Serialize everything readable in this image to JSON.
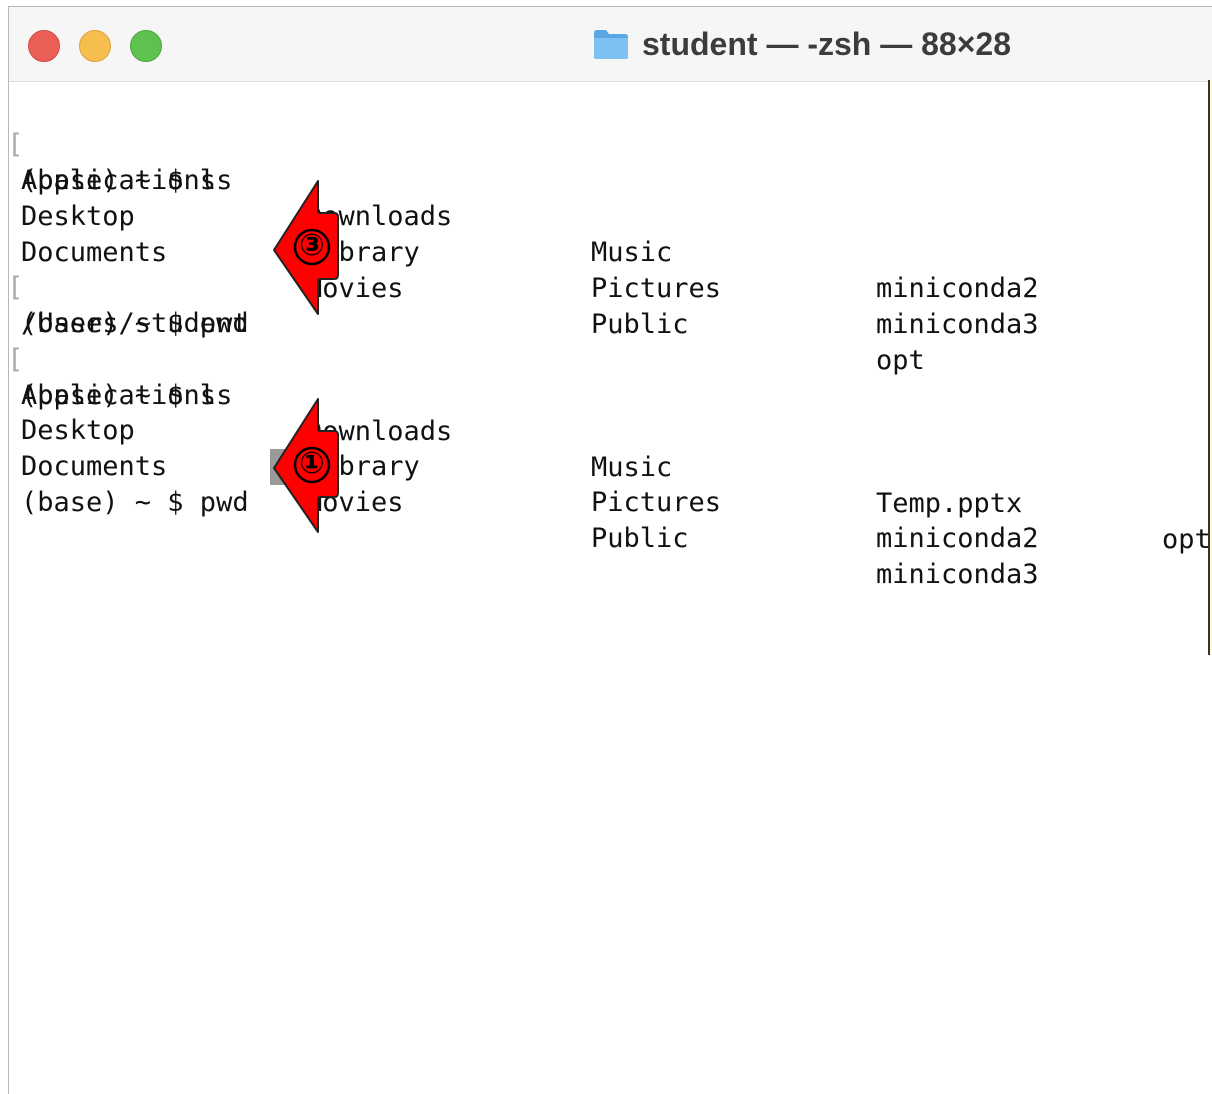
{
  "window": {
    "title": "student — -zsh — 88×28",
    "traffic_lights": {
      "close_color": "#ec5f56",
      "minimize_color": "#f6bd4f",
      "maximize_color": "#5fc150"
    },
    "title_icon": "folder-icon"
  },
  "terminal": {
    "lines": [
      {
        "prompt": "(base) ~ $ ls",
        "bracket": "["
      },
      {
        "cols": [
          "Applications",
          "Downloads",
          "Music",
          "miniconda2"
        ]
      },
      {
        "cols": [
          "Desktop",
          "Library",
          "Pictures",
          "miniconda3"
        ]
      },
      {
        "cols": [
          "Documents",
          "Movies",
          "Public",
          "opt"
        ]
      },
      {
        "prompt": "(base) ~ $ pwd",
        "bracket": "["
      },
      {
        "text": "/Users/student"
      },
      {
        "prompt": "(base) ~ $ ls",
        "bracket": "["
      },
      {
        "cols": [
          "Applications",
          "Downloads",
          "Music",
          "Temp.pptx",
          "opt"
        ]
      },
      {
        "cols": [
          "Desktop",
          "Library",
          "Pictures",
          "miniconda2"
        ]
      },
      {
        "cols": [
          "Documents",
          "Movies",
          "Public",
          "miniconda3"
        ]
      },
      {
        "prompt": "(base) ~ $ pwd"
      }
    ]
  },
  "annotations": {
    "callout_3": "③",
    "callout_1": "①",
    "arrow_color": "#ff0000"
  }
}
